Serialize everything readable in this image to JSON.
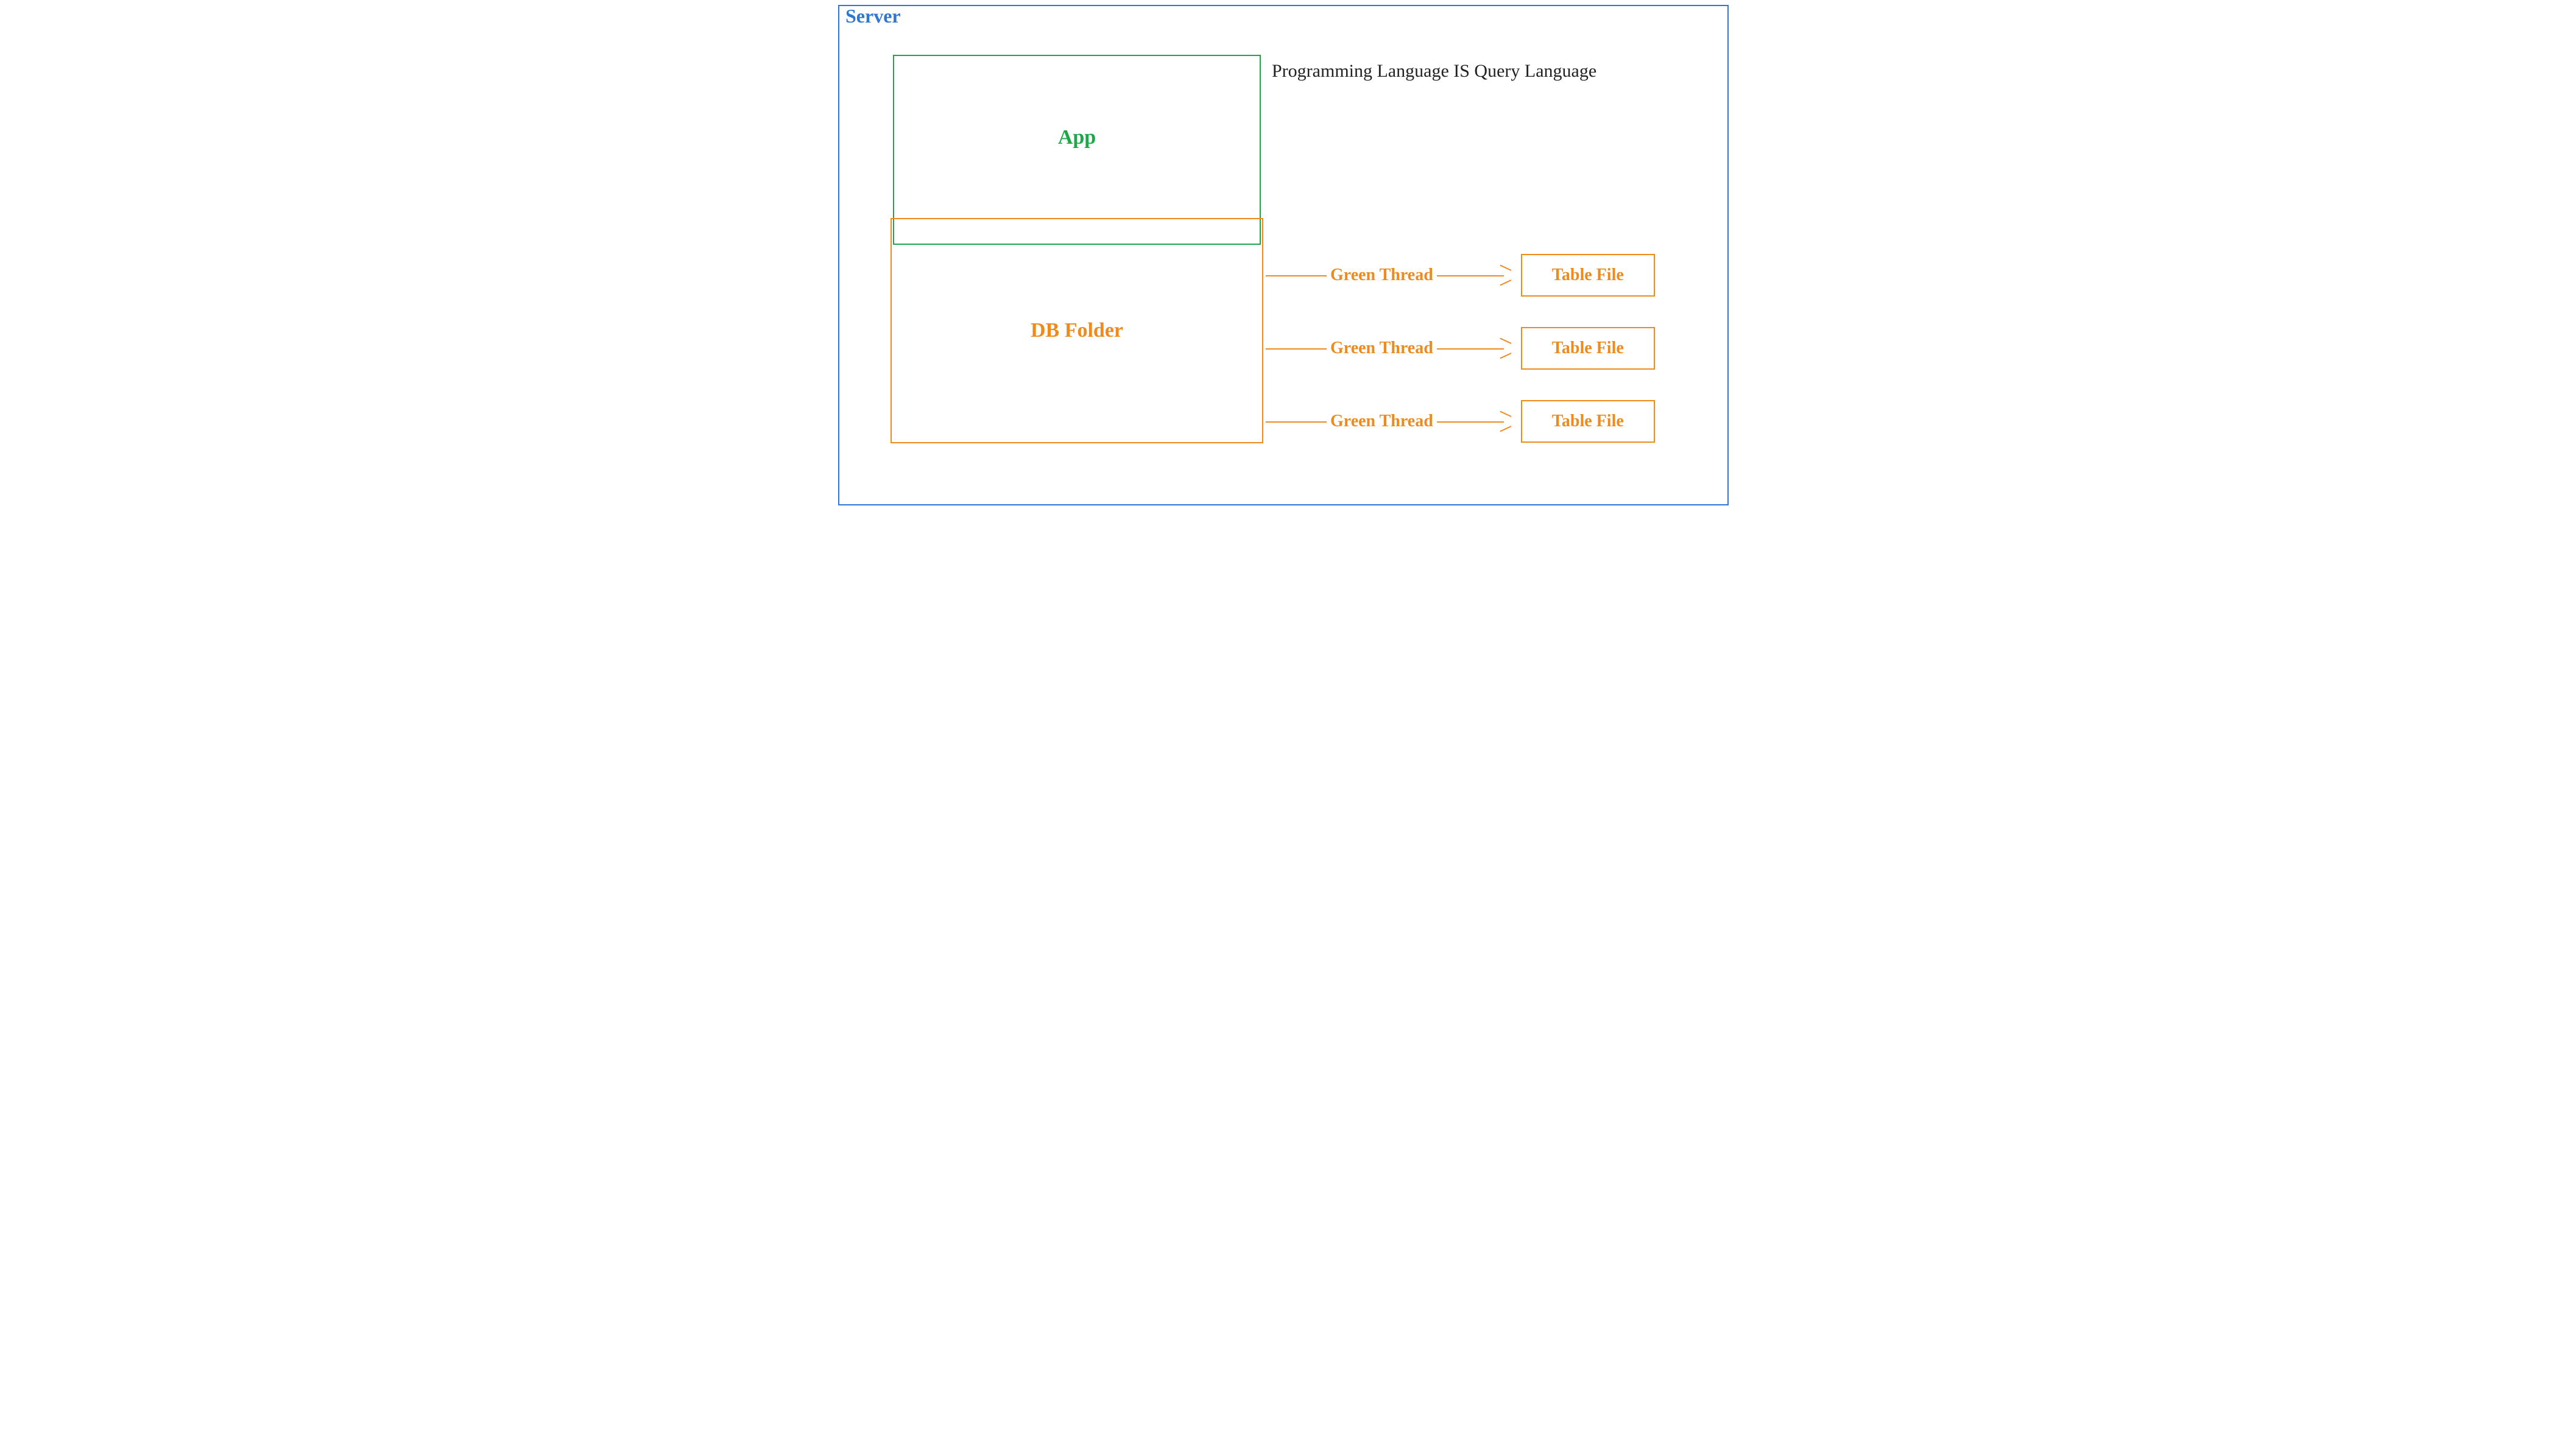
{
  "server": {
    "label": "Server"
  },
  "app": {
    "label": "App"
  },
  "db": {
    "label": "DB Folder"
  },
  "tagline": "Programming Language IS Query Language",
  "threads": [
    {
      "label": "Green Thread",
      "table": "Table File"
    },
    {
      "label": "Green Thread",
      "table": "Table File"
    },
    {
      "label": "Green Thread",
      "table": "Table File"
    }
  ],
  "colors": {
    "server": "#2f77d1",
    "app": "#1fa648",
    "db": "#ee8b1f",
    "text": "#222222"
  }
}
